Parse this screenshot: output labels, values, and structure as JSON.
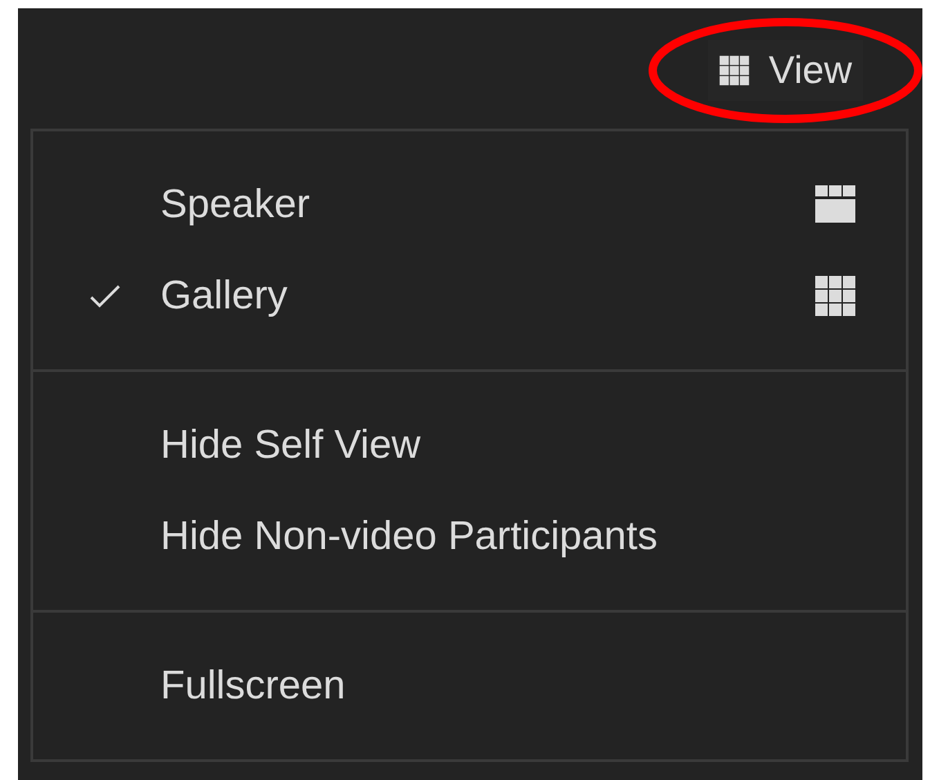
{
  "view_button": {
    "label": "View",
    "kind": "gallery",
    "highlighted": true
  },
  "menu": {
    "sections": [
      {
        "items": [
          {
            "label": "Speaker",
            "checked": false,
            "kind": "speaker"
          },
          {
            "label": "Gallery",
            "checked": true,
            "kind": "gallery"
          }
        ]
      },
      {
        "items": [
          {
            "label": "Hide Self View",
            "checked": false,
            "kind": "plain"
          },
          {
            "label": "Hide Non-video Participants",
            "checked": false,
            "kind": "plain"
          }
        ]
      },
      {
        "items": [
          {
            "label": "Fullscreen",
            "checked": false,
            "kind": "plain"
          }
        ]
      }
    ]
  }
}
